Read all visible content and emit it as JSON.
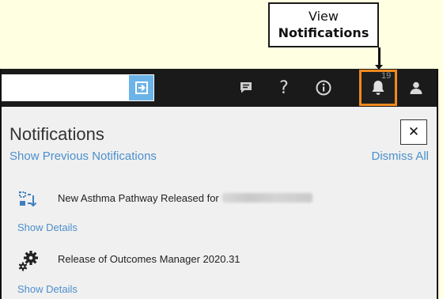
{
  "callout": {
    "line1": "View",
    "line2": "Notifications"
  },
  "toolbar": {
    "search_value": "",
    "notification_count": "19",
    "icons": [
      "enter-icon",
      "chat-icon",
      "help-icon",
      "info-icon",
      "bell-icon",
      "user-icon"
    ],
    "accent": "#f08a1f"
  },
  "panel": {
    "title": "Notifications",
    "show_previous": "Show Previous Notifications",
    "dismiss_all": "Dismiss All",
    "close": "✕"
  },
  "notifications": [
    {
      "icon": "pathway-icon",
      "text": "New Asthma Pathway Released for",
      "link": "Show Details"
    },
    {
      "icon": "gears-icon",
      "text": "Release of Outcomes Manager 2020.31",
      "link": "Show Details"
    }
  ]
}
